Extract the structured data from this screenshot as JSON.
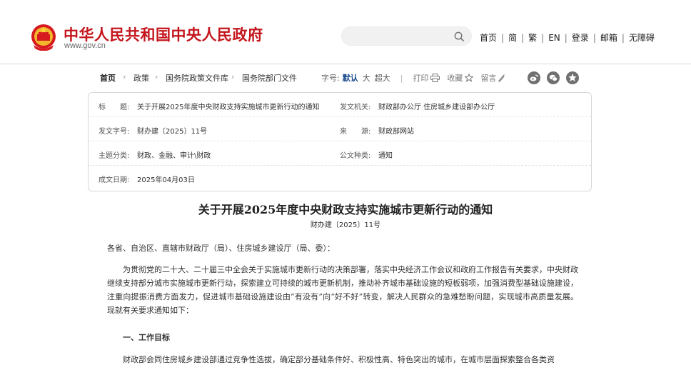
{
  "header": {
    "site_name": "中华人民共和国中央人民政府",
    "site_url": "www.gov.cn",
    "search_placeholder": "",
    "nav": [
      "首页",
      "简",
      "繁",
      "EN",
      "登录",
      "邮箱",
      "无障碍"
    ]
  },
  "breadcrumb": [
    "首页",
    "政策",
    "国务院政策文件库",
    "国务院部门文件"
  ],
  "toolbar": {
    "font_label": "字号:",
    "font_default": "默认",
    "font_large": "大",
    "font_xlarge": "超大",
    "divider": "|",
    "print": "打印",
    "favorite": "收藏",
    "comment": "留言"
  },
  "info": {
    "title_label": "标　　题:",
    "title_value": "关于开展2025年度中央财政支持实施城市更新行动的通知",
    "issuer_label": "发文机关:",
    "issuer_value": "财政部办公厅  住房城乡建设部办公厅",
    "doc_no_label": "发文字号:",
    "doc_no_value": "财办建〔2025〕11号",
    "source_label": "来　　源:",
    "source_value": "财政部网站",
    "topic_label": "主题分类:",
    "topic_value": "财政、金融、审计\\财政",
    "type_label": "公文种类:",
    "type_value": "通知",
    "date_label": "成文日期:",
    "date_value": "2025年04月03日"
  },
  "article": {
    "title": "关于开展2025年度中央财政支持实施城市更新行动的通知",
    "doc_number": "财办建〔2025〕11号",
    "greeting": "各省、自治区、直辖市财政厅（局）、住房城乡建设厅（局、委）：",
    "body": "为贯彻党的二十大、二十届三中全会关于实施城市更新行动的决策部署，落实中央经济工作会议和政府工作报告有关要求，中央财政继续支持部分城市实施城市更新行动，探索建立可持续的城市更新机制，推动补齐城市基础设施的短板弱项，加强消费型基础设施建设，注重向提振消费方面发力，促进城市基础设施建设由“有没有”向“好不好”转变，解决人民群众的急难愁盼问题，实现城市高质量发展。现就有关要求通知如下：",
    "section1": "一、工作目标",
    "section1_text": "财政部会同住房城乡建设部通过竞争性选拔，确定部分基础条件好、积极性高、特色突出的城市，在城市层面探索整合各类资"
  }
}
